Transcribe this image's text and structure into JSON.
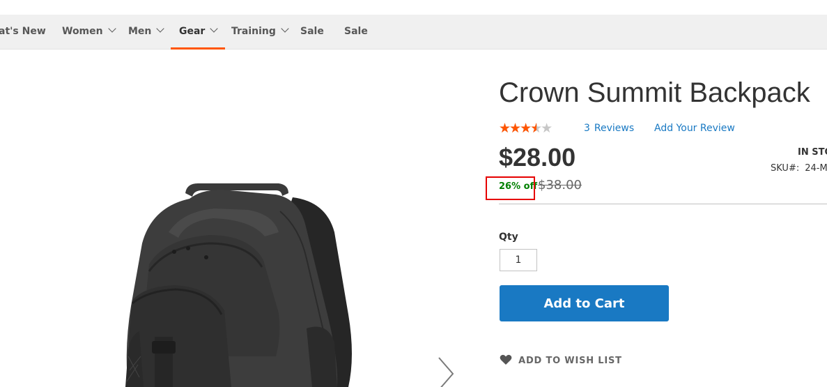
{
  "nav": {
    "items": [
      {
        "label": "at's New",
        "has_dropdown": false,
        "active": false
      },
      {
        "label": "Women",
        "has_dropdown": true,
        "active": false
      },
      {
        "label": "Men",
        "has_dropdown": true,
        "active": false
      },
      {
        "label": "Gear",
        "has_dropdown": true,
        "active": true
      },
      {
        "label": "Training",
        "has_dropdown": true,
        "active": false
      },
      {
        "label": "Sale",
        "has_dropdown": false,
        "active": false
      },
      {
        "label": "Sale",
        "has_dropdown": false,
        "active": false
      }
    ],
    "active_underline_color": "#ff5501"
  },
  "gallery": {
    "image_subject": "black backpack",
    "next_icon": "chevron-right-icon"
  },
  "product": {
    "title": "Crown Summit Backpack",
    "rating": {
      "stars_glyphs": "★★★★★",
      "percent": 60,
      "max_stars": 5,
      "filled_color": "#ff5501",
      "empty_color": "#c7c7c7"
    },
    "reviews": {
      "count": "3",
      "label": "Reviews",
      "add_review": "Add Your Review"
    },
    "price": "$28.00",
    "old_price": "$38.00",
    "discount": "26% off",
    "stock_status": "IN STO",
    "sku_label": "SKU#:",
    "sku_value": "24-M"
  },
  "form": {
    "qty_label": "Qty",
    "qty_value": "1",
    "add_to_cart": "Add to Cart",
    "add_to_cart_color": "#1979c3"
  },
  "wishlist": {
    "label": "ADD TO WISH LIST",
    "icon": "heart-icon"
  },
  "highlight": {
    "color": "#e60000",
    "target": "discount"
  }
}
